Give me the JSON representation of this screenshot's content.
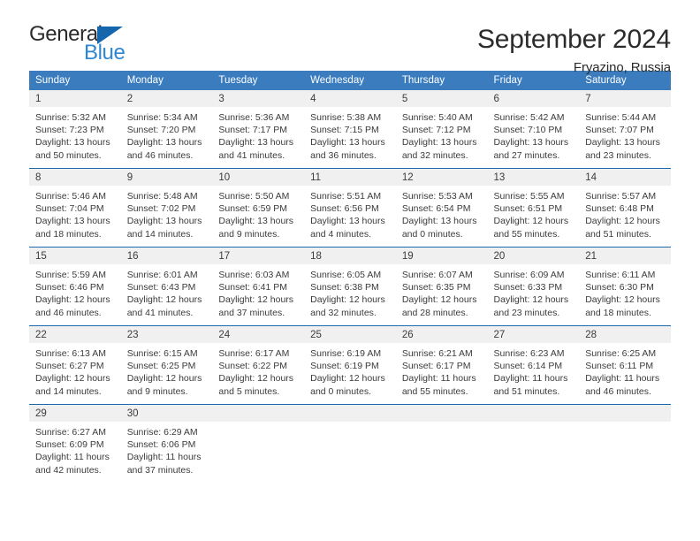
{
  "brand": {
    "name_top": "General",
    "name_bottom": "Blue",
    "triangle_color": "#1566ad",
    "blue_text_color": "#2f87d1"
  },
  "header": {
    "title": "September 2024",
    "subtitle": "Fryazino, Russia"
  },
  "colors": {
    "header_row_bg": "#3b7cbf",
    "header_row_text": "#ffffff",
    "week_separator": "#1a6aad",
    "daynum_band_bg": "#f0f0f0",
    "body_text": "#3b3b3b"
  },
  "weekday_headers": [
    "Sunday",
    "Monday",
    "Tuesday",
    "Wednesday",
    "Thursday",
    "Friday",
    "Saturday"
  ],
  "weeks": [
    [
      {
        "day": "1",
        "sunrise": "Sunrise: 5:32 AM",
        "sunset": "Sunset: 7:23 PM",
        "daylight1": "Daylight: 13 hours",
        "daylight2": "and 50 minutes."
      },
      {
        "day": "2",
        "sunrise": "Sunrise: 5:34 AM",
        "sunset": "Sunset: 7:20 PM",
        "daylight1": "Daylight: 13 hours",
        "daylight2": "and 46 minutes."
      },
      {
        "day": "3",
        "sunrise": "Sunrise: 5:36 AM",
        "sunset": "Sunset: 7:17 PM",
        "daylight1": "Daylight: 13 hours",
        "daylight2": "and 41 minutes."
      },
      {
        "day": "4",
        "sunrise": "Sunrise: 5:38 AM",
        "sunset": "Sunset: 7:15 PM",
        "daylight1": "Daylight: 13 hours",
        "daylight2": "and 36 minutes."
      },
      {
        "day": "5",
        "sunrise": "Sunrise: 5:40 AM",
        "sunset": "Sunset: 7:12 PM",
        "daylight1": "Daylight: 13 hours",
        "daylight2": "and 32 minutes."
      },
      {
        "day": "6",
        "sunrise": "Sunrise: 5:42 AM",
        "sunset": "Sunset: 7:10 PM",
        "daylight1": "Daylight: 13 hours",
        "daylight2": "and 27 minutes."
      },
      {
        "day": "7",
        "sunrise": "Sunrise: 5:44 AM",
        "sunset": "Sunset: 7:07 PM",
        "daylight1": "Daylight: 13 hours",
        "daylight2": "and 23 minutes."
      }
    ],
    [
      {
        "day": "8",
        "sunrise": "Sunrise: 5:46 AM",
        "sunset": "Sunset: 7:04 PM",
        "daylight1": "Daylight: 13 hours",
        "daylight2": "and 18 minutes."
      },
      {
        "day": "9",
        "sunrise": "Sunrise: 5:48 AM",
        "sunset": "Sunset: 7:02 PM",
        "daylight1": "Daylight: 13 hours",
        "daylight2": "and 14 minutes."
      },
      {
        "day": "10",
        "sunrise": "Sunrise: 5:50 AM",
        "sunset": "Sunset: 6:59 PM",
        "daylight1": "Daylight: 13 hours",
        "daylight2": "and 9 minutes."
      },
      {
        "day": "11",
        "sunrise": "Sunrise: 5:51 AM",
        "sunset": "Sunset: 6:56 PM",
        "daylight1": "Daylight: 13 hours",
        "daylight2": "and 4 minutes."
      },
      {
        "day": "12",
        "sunrise": "Sunrise: 5:53 AM",
        "sunset": "Sunset: 6:54 PM",
        "daylight1": "Daylight: 13 hours",
        "daylight2": "and 0 minutes."
      },
      {
        "day": "13",
        "sunrise": "Sunrise: 5:55 AM",
        "sunset": "Sunset: 6:51 PM",
        "daylight1": "Daylight: 12 hours",
        "daylight2": "and 55 minutes."
      },
      {
        "day": "14",
        "sunrise": "Sunrise: 5:57 AM",
        "sunset": "Sunset: 6:48 PM",
        "daylight1": "Daylight: 12 hours",
        "daylight2": "and 51 minutes."
      }
    ],
    [
      {
        "day": "15",
        "sunrise": "Sunrise: 5:59 AM",
        "sunset": "Sunset: 6:46 PM",
        "daylight1": "Daylight: 12 hours",
        "daylight2": "and 46 minutes."
      },
      {
        "day": "16",
        "sunrise": "Sunrise: 6:01 AM",
        "sunset": "Sunset: 6:43 PM",
        "daylight1": "Daylight: 12 hours",
        "daylight2": "and 41 minutes."
      },
      {
        "day": "17",
        "sunrise": "Sunrise: 6:03 AM",
        "sunset": "Sunset: 6:41 PM",
        "daylight1": "Daylight: 12 hours",
        "daylight2": "and 37 minutes."
      },
      {
        "day": "18",
        "sunrise": "Sunrise: 6:05 AM",
        "sunset": "Sunset: 6:38 PM",
        "daylight1": "Daylight: 12 hours",
        "daylight2": "and 32 minutes."
      },
      {
        "day": "19",
        "sunrise": "Sunrise: 6:07 AM",
        "sunset": "Sunset: 6:35 PM",
        "daylight1": "Daylight: 12 hours",
        "daylight2": "and 28 minutes."
      },
      {
        "day": "20",
        "sunrise": "Sunrise: 6:09 AM",
        "sunset": "Sunset: 6:33 PM",
        "daylight1": "Daylight: 12 hours",
        "daylight2": "and 23 minutes."
      },
      {
        "day": "21",
        "sunrise": "Sunrise: 6:11 AM",
        "sunset": "Sunset: 6:30 PM",
        "daylight1": "Daylight: 12 hours",
        "daylight2": "and 18 minutes."
      }
    ],
    [
      {
        "day": "22",
        "sunrise": "Sunrise: 6:13 AM",
        "sunset": "Sunset: 6:27 PM",
        "daylight1": "Daylight: 12 hours",
        "daylight2": "and 14 minutes."
      },
      {
        "day": "23",
        "sunrise": "Sunrise: 6:15 AM",
        "sunset": "Sunset: 6:25 PM",
        "daylight1": "Daylight: 12 hours",
        "daylight2": "and 9 minutes."
      },
      {
        "day": "24",
        "sunrise": "Sunrise: 6:17 AM",
        "sunset": "Sunset: 6:22 PM",
        "daylight1": "Daylight: 12 hours",
        "daylight2": "and 5 minutes."
      },
      {
        "day": "25",
        "sunrise": "Sunrise: 6:19 AM",
        "sunset": "Sunset: 6:19 PM",
        "daylight1": "Daylight: 12 hours",
        "daylight2": "and 0 minutes."
      },
      {
        "day": "26",
        "sunrise": "Sunrise: 6:21 AM",
        "sunset": "Sunset: 6:17 PM",
        "daylight1": "Daylight: 11 hours",
        "daylight2": "and 55 minutes."
      },
      {
        "day": "27",
        "sunrise": "Sunrise: 6:23 AM",
        "sunset": "Sunset: 6:14 PM",
        "daylight1": "Daylight: 11 hours",
        "daylight2": "and 51 minutes."
      },
      {
        "day": "28",
        "sunrise": "Sunrise: 6:25 AM",
        "sunset": "Sunset: 6:11 PM",
        "daylight1": "Daylight: 11 hours",
        "daylight2": "and 46 minutes."
      }
    ],
    [
      {
        "day": "29",
        "sunrise": "Sunrise: 6:27 AM",
        "sunset": "Sunset: 6:09 PM",
        "daylight1": "Daylight: 11 hours",
        "daylight2": "and 42 minutes."
      },
      {
        "day": "30",
        "sunrise": "Sunrise: 6:29 AM",
        "sunset": "Sunset: 6:06 PM",
        "daylight1": "Daylight: 11 hours",
        "daylight2": "and 37 minutes."
      },
      {
        "day": "",
        "sunrise": "",
        "sunset": "",
        "daylight1": "",
        "daylight2": ""
      },
      {
        "day": "",
        "sunrise": "",
        "sunset": "",
        "daylight1": "",
        "daylight2": ""
      },
      {
        "day": "",
        "sunrise": "",
        "sunset": "",
        "daylight1": "",
        "daylight2": ""
      },
      {
        "day": "",
        "sunrise": "",
        "sunset": "",
        "daylight1": "",
        "daylight2": ""
      },
      {
        "day": "",
        "sunrise": "",
        "sunset": "",
        "daylight1": "",
        "daylight2": ""
      }
    ]
  ]
}
